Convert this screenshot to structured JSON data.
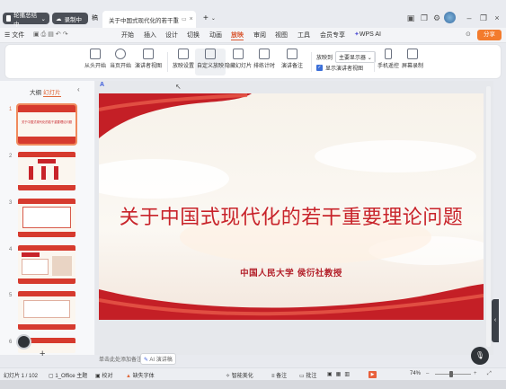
{
  "topbar": {
    "pill1": "轮播总结中",
    "pill2": "录制中",
    "tab_partial": "稿",
    "doc_tab": "关于中国式现代化的若干重",
    "new_tab": "+"
  },
  "menubar": {
    "file": "文件",
    "items": [
      "开始",
      "插入",
      "设计",
      "切换",
      "动画",
      "放映",
      "审阅",
      "视图",
      "工具",
      "会员专享"
    ],
    "active": "放映",
    "wps_ai": "WPS AI",
    "share": "分享"
  },
  "ribbon": {
    "buttons": [
      "从头开始",
      "当页开始",
      "演讲者视图",
      "放映设置",
      "自定义放映",
      "隐藏幻灯片",
      "排练计时",
      "演讲备注"
    ],
    "screen_label": "放映到",
    "screen_value": "主要显示器",
    "presenter_check": "显示演讲者视图",
    "right_buttons": [
      "手机遥控",
      "屏幕录制"
    ]
  },
  "left_panel": {
    "tab_outline": "大纲",
    "tab_slides": "幻灯片",
    "thumb_numbers": [
      "1",
      "2",
      "3",
      "4",
      "5",
      "6"
    ],
    "thumb1_title": "关于中国式现代化的若干重要理论问题"
  },
  "slide": {
    "title": "关于中国式现代化的若干重要理论问题",
    "subtitle": "中国人民大学  侯衍社教授"
  },
  "notes": {
    "placeholder": "单击此处添加备注",
    "ai_label": "AI 演讲稿"
  },
  "status": {
    "slide_info": "幻灯片 1 / 102",
    "theme": "1_Office 主题",
    "proof": "校对",
    "missing_font": "缺失字体",
    "smart_beautify": "智能美化",
    "notes_btn": "备注",
    "comment": "批注",
    "zoom": "74%"
  },
  "colors": {
    "accent_orange": "#f08a5d",
    "slide_red": "#c8232a",
    "ribbon_bg": "#ffffff"
  }
}
